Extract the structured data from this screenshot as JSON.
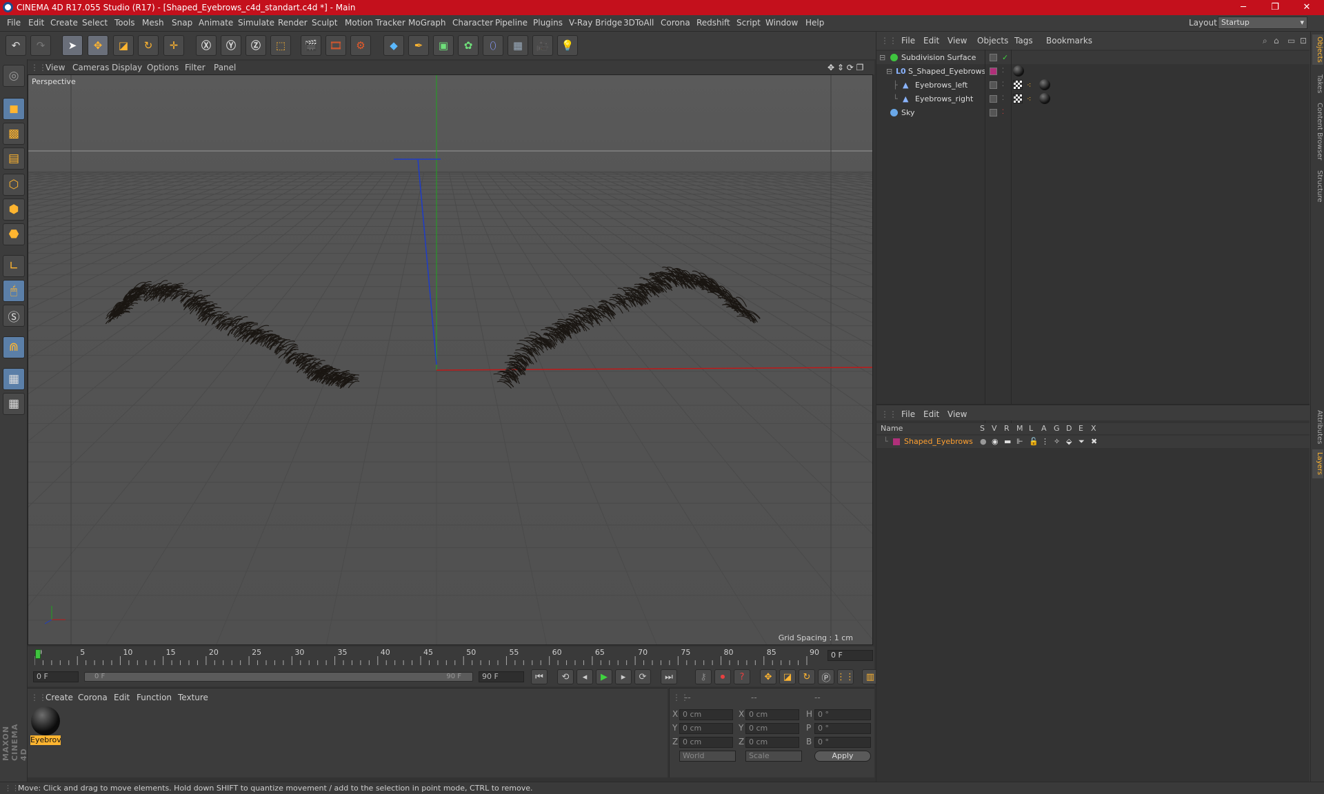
{
  "window": {
    "title": "CINEMA 4D R17.055 Studio (R17) - [Shaped_Eyebrows_c4d_standart.c4d *] - Main",
    "minimize": "─",
    "maximize": "❐",
    "close": "✕"
  },
  "menu": [
    "File",
    "Edit",
    "Create",
    "Select",
    "Tools",
    "Mesh",
    "Snap",
    "Animate",
    "Simulate",
    "Render",
    "Sculpt",
    "Motion Tracker",
    "MoGraph",
    "Character",
    "Pipeline",
    "Plugins",
    "V-Ray Bridge",
    "3DToAll",
    "Corona",
    "Redshift",
    "Script",
    "Window",
    "Help"
  ],
  "layout": {
    "label": "Layout:",
    "value": "Startup"
  },
  "viewport": {
    "menu": [
      "View",
      "Cameras",
      "Display",
      "Options",
      "Filter",
      "Panel"
    ],
    "camera_label": "Perspective",
    "grid_spacing": "Grid Spacing : 1 cm"
  },
  "timeline": {
    "ticks": [
      "0",
      "5",
      "10",
      "15",
      "20",
      "25",
      "30",
      "35",
      "40",
      "45",
      "50",
      "55",
      "60",
      "65",
      "70",
      "75",
      "80",
      "85",
      "90"
    ],
    "current_frame": "0 F",
    "start": "0 F",
    "range_start": "0 F",
    "range_end": "90 F",
    "end": "90 F"
  },
  "object_manager": {
    "menu": [
      "File",
      "Edit",
      "View",
      "Objects",
      "Tags",
      "Bookmarks"
    ],
    "objects": [
      {
        "name": "Subdivision Surface",
        "indent": 0
      },
      {
        "name": "S_Shaped_Eyebrows",
        "indent": 1
      },
      {
        "name": "Eyebrows_left",
        "indent": 2
      },
      {
        "name": "Eyebrows_right",
        "indent": 2
      },
      {
        "name": "Sky",
        "indent": 0
      }
    ]
  },
  "layer_manager": {
    "menu": [
      "File",
      "Edit",
      "View"
    ],
    "columns": [
      "Name",
      "S",
      "V",
      "R",
      "M",
      "L",
      "A",
      "G",
      "D",
      "E",
      "X"
    ],
    "layers": [
      {
        "name": "Shaped_Eyebrows",
        "color": "#b0307a"
      }
    ]
  },
  "material_manager": {
    "menu": [
      "Create",
      "Corona",
      "Edit",
      "Function",
      "Texture"
    ],
    "materials": [
      {
        "name": "Eyebrov"
      }
    ]
  },
  "coordinates": {
    "header": [
      "--",
      "--",
      "--"
    ],
    "rows": [
      {
        "a": "X",
        "av": "0 cm",
        "b": "X",
        "bv": "0 cm",
        "c": "H",
        "cv": "0 °"
      },
      {
        "a": "Y",
        "av": "0 cm",
        "b": "Y",
        "bv": "0 cm",
        "c": "P",
        "cv": "0 °"
      },
      {
        "a": "Z",
        "av": "0 cm",
        "b": "Z",
        "bv": "0 cm",
        "c": "B",
        "cv": "0 °"
      }
    ],
    "mode1": "World",
    "mode2": "Scale",
    "apply": "Apply"
  },
  "side_tabs": [
    "Objects",
    "Takes",
    "Content Browser",
    "Structure",
    "Attributes",
    "Layers"
  ],
  "status": "Move: Click and drag to move elements. Hold down SHIFT to quantize movement / add to the selection in point mode, CTRL to remove.",
  "maxon_logo": "MAXON CINEMA 4D",
  "colors": {
    "title_bar": "#c4101c",
    "accent": "#ffb530",
    "layer_name": "#ffa030"
  }
}
